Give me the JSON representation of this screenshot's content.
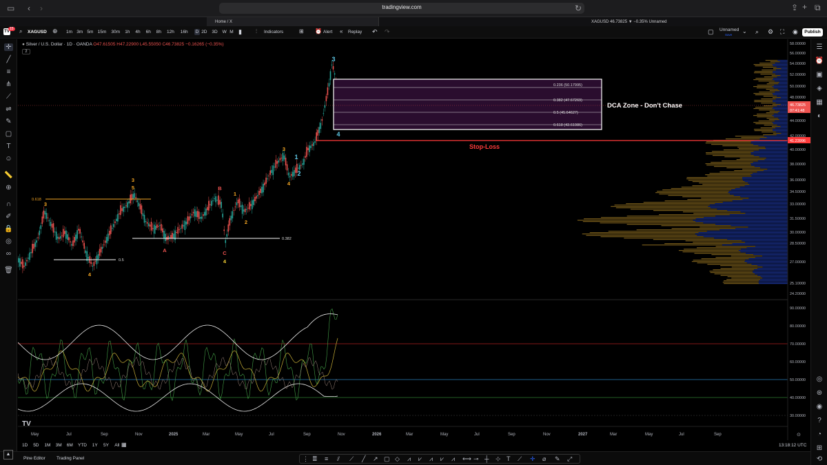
{
  "browser": {
    "url": "tradingview.com",
    "tabs": [
      {
        "label": "Home / X"
      },
      {
        "label": "XAGUSD 46.73825 ▼ −0.35% Unnamed"
      }
    ]
  },
  "toolbar": {
    "alert_count": "15",
    "symbol": "XAGUSD",
    "timeframes": [
      "1m",
      "3m",
      "5m",
      "15m",
      "30m",
      "1h",
      "4h",
      "6h",
      "8h",
      "12h",
      "16h",
      "D",
      "2D",
      "3D",
      "W",
      "M"
    ],
    "selected_timeframe": "D",
    "indicators_label": "Indicators",
    "alert_label": "Alert",
    "replay_label": "Replay",
    "layout_name": "Unnamed",
    "save_label": "Save",
    "publish_label": "Publish"
  },
  "legend": {
    "title": "Silver / U.S. Dollar · 1D · OANDA",
    "open": "O47.61505",
    "high": "H47.22900",
    "low": "L45.55050",
    "close": "C46.73825",
    "change": "−0.16265 (−0.35%)",
    "indicator_count": "2"
  },
  "annotations": {
    "dca_zone": "DCA Zone - Don't Chase",
    "stop_loss": "Stop-Loss",
    "fib_levels": [
      "0.236 (50.17995)",
      "0.382 (47.67269)",
      "0.5 (45.64627)",
      "0.618 (43.61986)"
    ],
    "fib_left_0618": "0.618",
    "fib_05": "0.5",
    "fib_0382": "0.382",
    "wave_labels": [
      {
        "t": "3",
        "c": "#f5a623"
      },
      {
        "t": "4",
        "c": "#f5a623"
      },
      {
        "t": "3",
        "c": "#f5a623"
      },
      {
        "t": "5",
        "c": "#f5a623"
      },
      {
        "t": "A",
        "c": "#ef5350"
      },
      {
        "t": "B",
        "c": "#ef5350"
      },
      {
        "t": "C",
        "c": "#ef5350"
      },
      {
        "t": "4",
        "c": "#f5d033"
      },
      {
        "t": "1",
        "c": "#f5a623"
      },
      {
        "t": "2",
        "c": "#f5a623"
      },
      {
        "t": "3",
        "c": "#f5a623"
      },
      {
        "t": "4",
        "c": "#f5a623"
      },
      {
        "t": "1",
        "c": "#5ec8e6"
      },
      {
        "t": "2",
        "c": "#5ec8e6"
      },
      {
        "t": "3",
        "c": "#5ec8e6"
      },
      {
        "t": "4",
        "c": "#5ec8e6"
      }
    ]
  },
  "price_axis": [
    "58.00000",
    "56.00000",
    "54.00000",
    "52.00000",
    "50.00000",
    "48.00000",
    "46.00000",
    "44.00000",
    "42.00000",
    "40.00000",
    "38.00000",
    "36.00000",
    "34.50000",
    "33.00000",
    "31.50000",
    "30.00000",
    "28.50000",
    "27.00000",
    "25.10000",
    "24.20000"
  ],
  "price_badges": {
    "current": "46.73825",
    "countdown": "07:41:48",
    "stop": "41.23996"
  },
  "oscillator_axis": [
    "90.00000",
    "80.00000",
    "70.00000",
    "60.00000",
    "50.00000",
    "40.00000",
    "30.00000"
  ],
  "time_axis": [
    "May",
    "Jul",
    "Sep",
    "Nov",
    "2025",
    "Mar",
    "May",
    "Jul",
    "Sep",
    "Nov",
    "2026",
    "Mar",
    "May",
    "Jul",
    "Sep",
    "Nov",
    "2027",
    "Mar",
    "May",
    "Jul",
    "Sep"
  ],
  "ranges": [
    "1D",
    "5D",
    "1M",
    "3M",
    "6M",
    "YTD",
    "1Y",
    "5Y",
    "All"
  ],
  "clock": "13:18:12 UTC",
  "footer": {
    "pine": "Pine Editor",
    "panel": "Trading Panel"
  },
  "colors": {
    "up": "#26a69a",
    "down": "#ef5350",
    "zone": "#2a0d2e",
    "stop": "#ff3b3b"
  }
}
